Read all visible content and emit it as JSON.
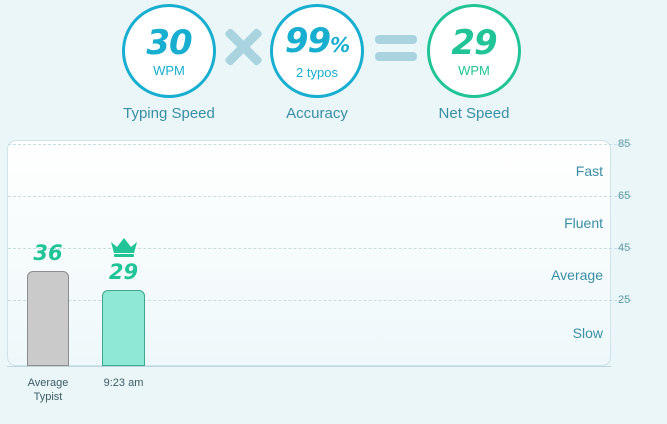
{
  "stats": {
    "speed": {
      "value": "30",
      "unit": "WPM",
      "label": "Typing Speed"
    },
    "accuracy": {
      "value": "99",
      "suffix": "%",
      "sub": "2 typos",
      "label": "Accuracy"
    },
    "net": {
      "value": "29",
      "unit": "WPM",
      "label": "Net Speed"
    }
  },
  "colors": {
    "accent": "#17aed0",
    "positive": "#20c497",
    "operator": "#a9d4df"
  },
  "chart_data": {
    "type": "bar",
    "y_ticks": [
      "85",
      "65",
      "45",
      "25"
    ],
    "zones": [
      "Fast",
      "Fluent",
      "Average",
      "Slow"
    ],
    "bars": [
      {
        "label_lines": [
          "Average",
          "Typist"
        ],
        "value": 36,
        "display": "36",
        "style": "avg"
      },
      {
        "label_lines": [
          "9:23 am"
        ],
        "value": 29,
        "display": "29",
        "style": "me",
        "crown": true
      }
    ],
    "ylim": [
      0,
      85
    ],
    "grid": true
  }
}
